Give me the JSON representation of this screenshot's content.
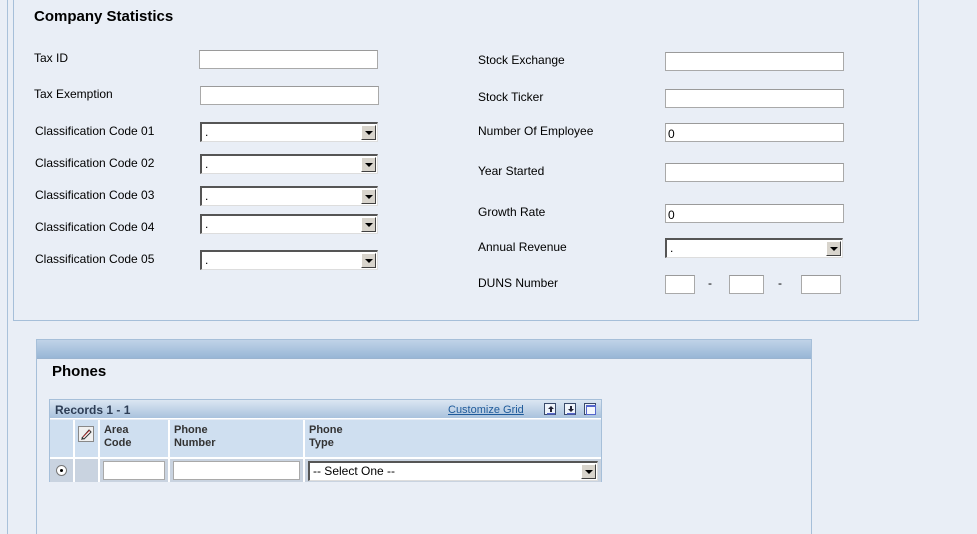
{
  "company_statistics": {
    "title": "Company Statistics",
    "left_fields": [
      {
        "label": "Tax ID",
        "type": "text",
        "value": ""
      },
      {
        "label": "Tax Exemption",
        "type": "text",
        "value": ""
      },
      {
        "label": "Classification Code 01",
        "type": "select",
        "value": "."
      },
      {
        "label": "Classification Code 02",
        "type": "select",
        "value": "."
      },
      {
        "label": "Classification Code 03",
        "type": "select",
        "value": "."
      },
      {
        "label": "Classification Code 04",
        "type": "select",
        "value": "."
      },
      {
        "label": "Classification Code 05",
        "type": "select",
        "value": "."
      }
    ],
    "right_fields": [
      {
        "label": "Stock Exchange",
        "type": "text",
        "value": ""
      },
      {
        "label": "Stock Ticker",
        "type": "text",
        "value": ""
      },
      {
        "label": "Number Of Employee",
        "type": "text",
        "value": "0"
      },
      {
        "label": "Year Started",
        "type": "text",
        "value": ""
      },
      {
        "label": "Growth Rate",
        "type": "text",
        "value": "0"
      },
      {
        "label": "Annual Revenue",
        "type": "select",
        "value": "."
      },
      {
        "label": "DUNS Number",
        "type": "duns",
        "parts": [
          "",
          "",
          ""
        ],
        "separator": "-"
      }
    ]
  },
  "phones": {
    "title": "Phones",
    "grid": {
      "records_label": "Records 1 - 1",
      "customize_label": "Customize Grid",
      "icons": [
        "export-icon",
        "import-icon",
        "maximize-icon"
      ],
      "columns": [
        "",
        "",
        "Area\nCode",
        "Phone\nNumber",
        "Phone\nType"
      ],
      "column_lines": [
        [
          "Area",
          "Code"
        ],
        [
          "Phone",
          "Number"
        ],
        [
          "Phone",
          "Type"
        ]
      ],
      "rows": [
        {
          "selected": true,
          "area_code": "",
          "phone_number": "",
          "phone_type": "-- Select One --"
        }
      ]
    }
  }
}
